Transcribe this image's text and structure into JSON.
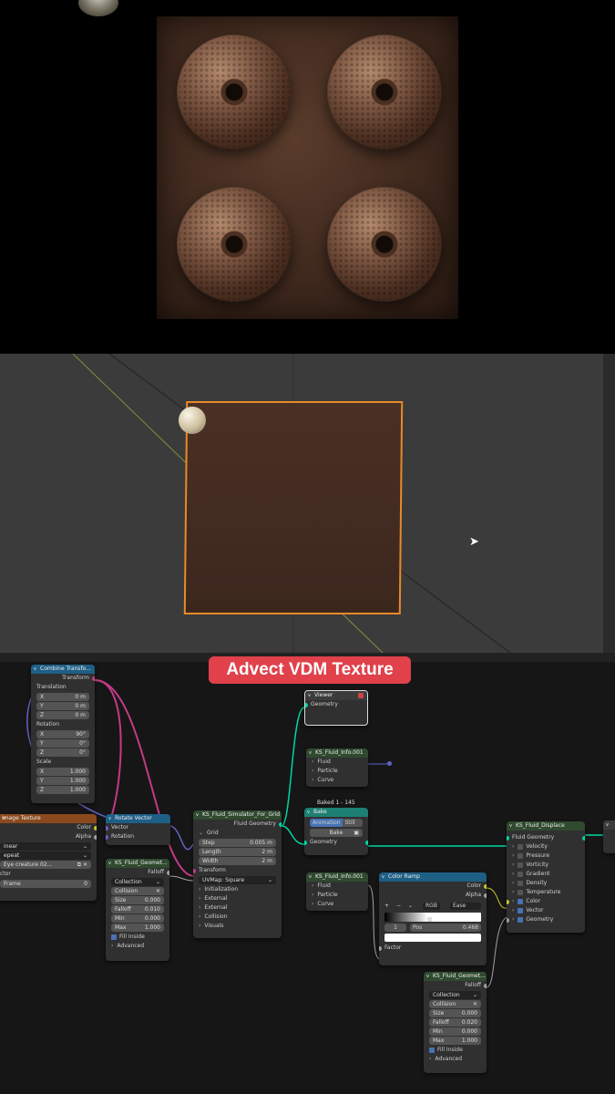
{
  "banner": {
    "title": "Advect VDM Texture"
  },
  "nodes": {
    "combine": {
      "title": "Combine Transfo...",
      "output": "Transform",
      "translation_label": "Translation",
      "translation": [
        {
          "axis": "X",
          "value": "0 m"
        },
        {
          "axis": "Y",
          "value": "0 m"
        },
        {
          "axis": "Z",
          "value": "0 m"
        }
      ],
      "rotation_label": "Rotation",
      "rotation": [
        {
          "axis": "X",
          "value": "90°"
        },
        {
          "axis": "Y",
          "value": "0°"
        },
        {
          "axis": "Z",
          "value": "0°"
        }
      ],
      "scale_label": "Scale",
      "scale": [
        {
          "axis": "X",
          "value": "1.000"
        },
        {
          "axis": "Y",
          "value": "1.000"
        },
        {
          "axis": "Z",
          "value": "1.000"
        }
      ]
    },
    "image_texture": {
      "title": "Image Texture",
      "outputs": [
        "Color",
        "Alpha"
      ],
      "interp": "inear",
      "extension": "epeat",
      "image": "Eye creature 02...",
      "ctor_label": "ctor",
      "frame_label": "Frame",
      "frame_value": "0"
    },
    "rotate_vector": {
      "title": "Rotate Vector",
      "inputs": [
        "Vector",
        "Rotation"
      ]
    },
    "ks_geom1": {
      "title": "KS_Fluid_Geomet...",
      "output": "Falloff",
      "collection_label": "Collection",
      "collision": "Collision",
      "fields": [
        {
          "label": "Size",
          "value": "0.000"
        },
        {
          "label": "Falloff",
          "value": "0.010"
        },
        {
          "label": "Min",
          "value": "0.000"
        },
        {
          "label": "Max",
          "value": "1.000"
        }
      ],
      "fill_inside": "Fill Inside",
      "advanced": "Advanced"
    },
    "simulator": {
      "title": "KS_Fluid_Simulator_For_Grid",
      "output": "Fluid Geometry",
      "grid_label": "Grid",
      "fields": [
        {
          "label": "Step",
          "value": "0.005 m"
        },
        {
          "label": "Length",
          "value": "2 m"
        },
        {
          "label": "Width",
          "value": "2 m"
        }
      ],
      "transform": "Transform",
      "uvmap": "UVMap: Square",
      "panels": [
        "Initialization",
        "External",
        "External",
        "Collision",
        "Visuals"
      ]
    },
    "viewer": {
      "title": "Viewer",
      "input": "Geometry"
    },
    "fluid_info1": {
      "title": "KS_Fluid_Info.001",
      "items": [
        "Fluid",
        "Particle",
        "Curve"
      ]
    },
    "bake": {
      "caption": "Baked 1 - 145",
      "title": "Bake",
      "animation": "Animation",
      "still": "Still",
      "bake_btn": "Bake",
      "geometry": "Geometry"
    },
    "fluid_info2": {
      "title": "KS_Fluid_Info.001",
      "items": [
        "Fluid",
        "Particle",
        "Curve"
      ]
    },
    "color_ramp": {
      "title": "Color Ramp",
      "outputs": [
        "Color",
        "Alpha"
      ],
      "mode": "RGB",
      "interp": "Ease",
      "stop_index": "1",
      "pos_label": "Pos",
      "pos_value": "0.468",
      "input": "Factor"
    },
    "displace": {
      "title": "KS_Fluid_Displace",
      "input": "Fluid Geometry",
      "items": [
        {
          "label": "Velocity",
          "checked": false
        },
        {
          "label": "Pressure",
          "checked": false
        },
        {
          "label": "Vorticity",
          "checked": false
        },
        {
          "label": "Gradient",
          "checked": false
        },
        {
          "label": "Density",
          "checked": false
        },
        {
          "label": "Temperature",
          "checked": false
        },
        {
          "label": "Color",
          "checked": true
        },
        {
          "label": "Vector",
          "checked": true
        },
        {
          "label": "Geometry",
          "checked": true
        }
      ]
    },
    "ks_geom2": {
      "title": "KS_Fluid_Geomet...",
      "output": "Falloff",
      "collection_label": "Collection",
      "collision": "Collision",
      "fields": [
        {
          "label": "Size",
          "value": "0.000"
        },
        {
          "label": "Falloff",
          "value": "0.020"
        },
        {
          "label": "Min",
          "value": "0.000"
        },
        {
          "label": "Max",
          "value": "1.000"
        }
      ],
      "fill_inside": "Fill Inside",
      "advanced": "Advanced"
    }
  },
  "colors": {
    "banner": "#e0414b",
    "geometry_wire": "#00d6a3",
    "matrix_wire": "#c23b86",
    "vector_wire": "#6363c7",
    "selection": "#e88a2a"
  }
}
